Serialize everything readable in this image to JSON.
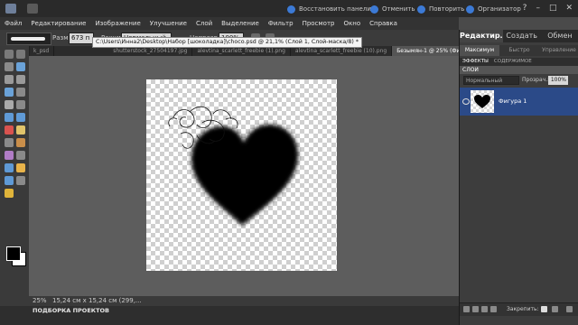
{
  "topbar": {
    "controls": [
      {
        "label": "Восстановить панели"
      },
      {
        "label": "Отменить"
      },
      {
        "label": "Повторить"
      },
      {
        "label": "Организатор"
      }
    ],
    "window_buttons": [
      "?",
      "–",
      "□",
      "✕"
    ]
  },
  "menu": [
    "Файл",
    "Редактирование",
    "Изображение",
    "Улучшение",
    "Слой",
    "Выделение",
    "Фильтр",
    "Просмотр",
    "Окно",
    "Справка"
  ],
  "options": {
    "size_label": "Разм.:",
    "size_value": "673 п",
    "mode_label": "Режим:",
    "mode_value": "Нормальный",
    "opacity_label": "Непрозр.:",
    "opacity_value": "100%"
  },
  "tooltip": "C:\\Users\\Инна2\\Desktop\\Набор [шоколадка]\\choco.psd @ 21,1% (Слой 1, Слой-маска/8) *",
  "tabs": [
    {
      "label": "k_psd",
      "active": false
    },
    {
      "label": "shutterstock_27504197.jpg",
      "active": false
    },
    {
      "label": "alevtina_scarlett_freebie (1).png",
      "active": false
    },
    {
      "label": "alevtina_scarlett_freebie (10).png",
      "active": false
    },
    {
      "label": "Безымян-1 @ 25% (Фигура 1, RGB/8) *",
      "active": true
    }
  ],
  "status": {
    "zoom": "25%",
    "info": "15,24 см x 15,24 см (299,..."
  },
  "bottombar": {
    "title": "ПОДБОРКА ПРОЕКТОВ"
  },
  "right_panel": {
    "modes": [
      {
        "label": "Редактир.",
        "active": true
      },
      {
        "label": "Создать",
        "active": false
      },
      {
        "label": "Обмен",
        "active": false
      }
    ],
    "subtabs": [
      {
        "label": "Максимум",
        "active": true
      },
      {
        "label": "Быстро",
        "active": false
      },
      {
        "label": "Управление",
        "active": false
      }
    ],
    "panel_tabs": [
      {
        "label": "ЭФФЕКТЫ",
        "active": true
      },
      {
        "label": "СОДЕРЖИМОЕ",
        "active": false
      }
    ],
    "layers_header": "СЛОИ",
    "blend_mode": "Нормальный",
    "opacity_label": "Прозрач.:",
    "opacity_value": "100%",
    "layers": [
      {
        "name": "Фигура 1"
      }
    ],
    "lock_label": "Закрепить:"
  },
  "colors": {
    "accent": "#2b4a88",
    "ctrl_icon": "#3c7ad6"
  }
}
